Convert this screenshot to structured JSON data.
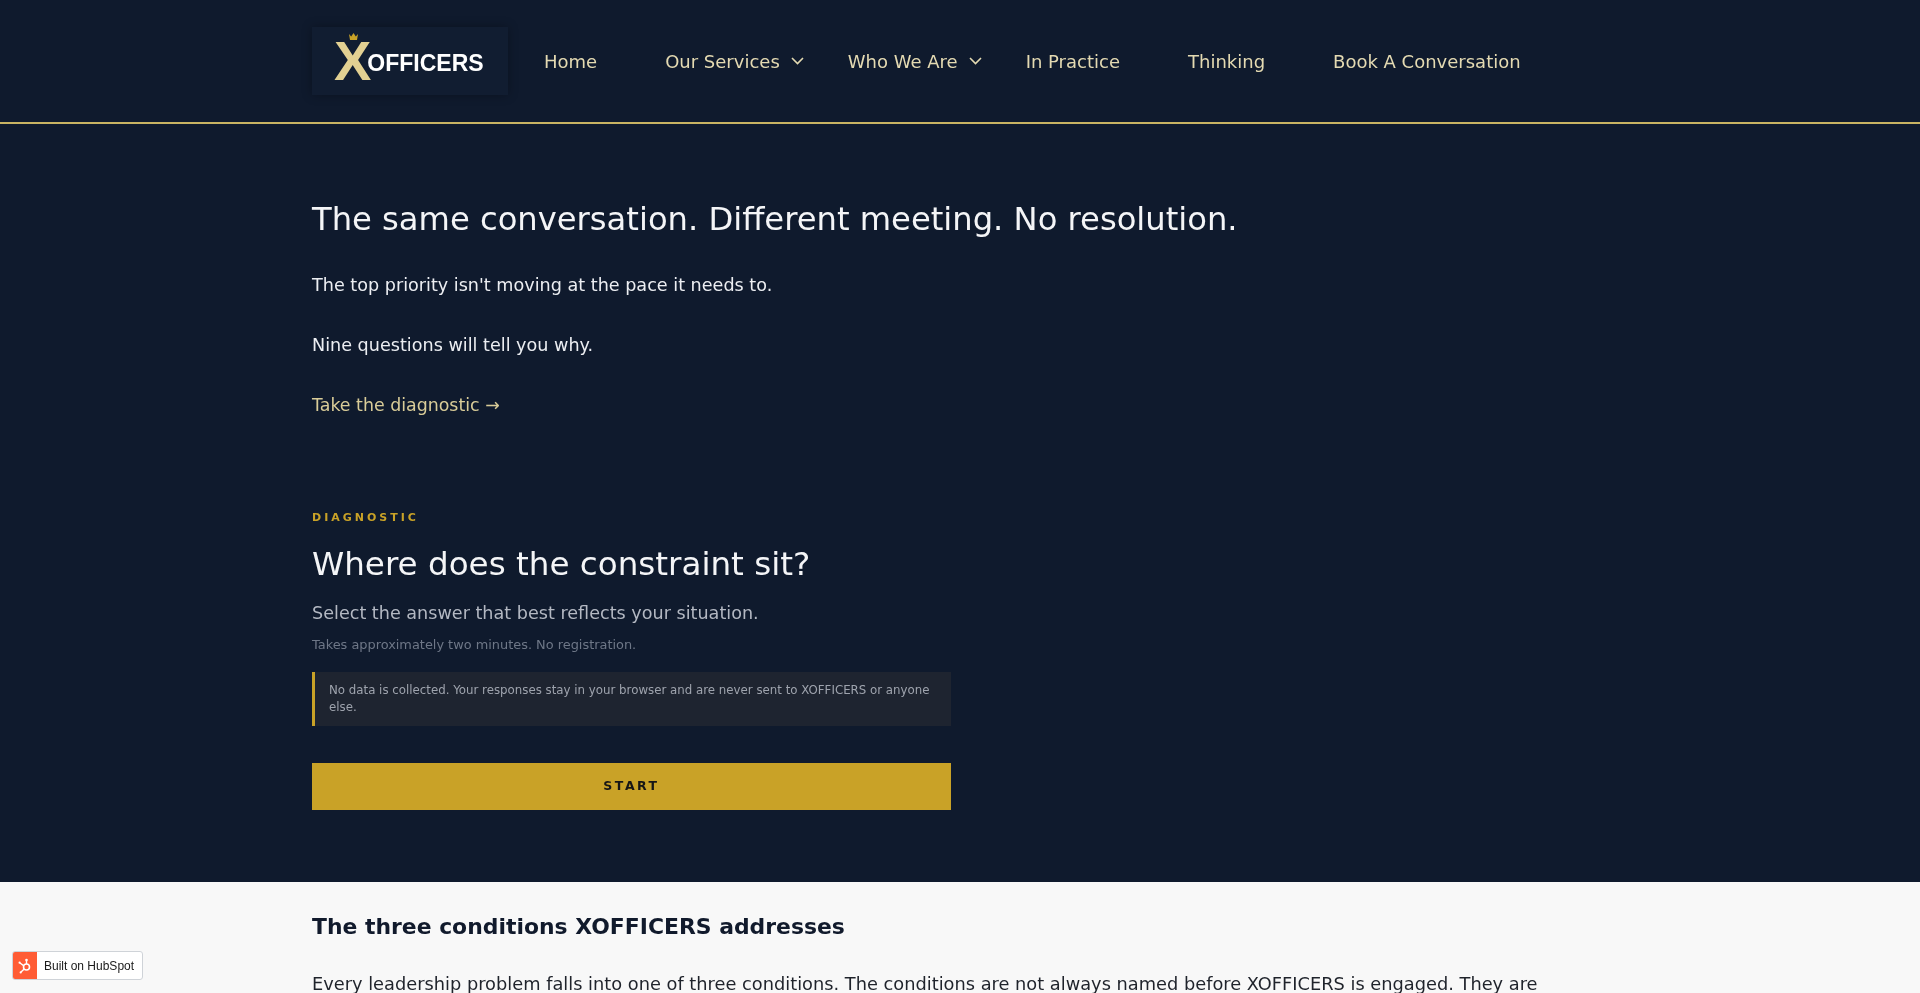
{
  "header": {
    "logo": {
      "mark": "X",
      "text": "OFFICERS"
    },
    "nav": [
      {
        "label": "Home",
        "dropdown": false
      },
      {
        "label": "Our Services",
        "dropdown": true
      },
      {
        "label": "Who We Are",
        "dropdown": true
      },
      {
        "label": "In Practice",
        "dropdown": false
      },
      {
        "label": "Thinking",
        "dropdown": false
      },
      {
        "label": "Book A Conversation",
        "dropdown": false
      }
    ]
  },
  "hero": {
    "title": "The same conversation. Different meeting. No resolution.",
    "paragraphs": [
      "The top priority isn't moving at the pace it needs to.",
      "Nine questions will tell you why."
    ],
    "link": "Take the diagnostic →"
  },
  "diagnostic": {
    "eyebrow": "DIAGNOSTIC",
    "title": "Where does the constraint sit?",
    "subtitle": "Select the answer that best reflects your situation.",
    "note": "Takes approximately two minutes. No registration.",
    "notice": "No data is collected. Your responses stay in your browser and are never sent to XOFFICERS or anyone else.",
    "start_button": "START"
  },
  "conditions": {
    "title": "The three conditions XOFFICERS addresses",
    "intro": "Every leadership problem falls into one of three conditions. The conditions are not always named before XOFFICERS is engaged. They are"
  },
  "badge": {
    "label": "Built on HubSpot"
  }
}
